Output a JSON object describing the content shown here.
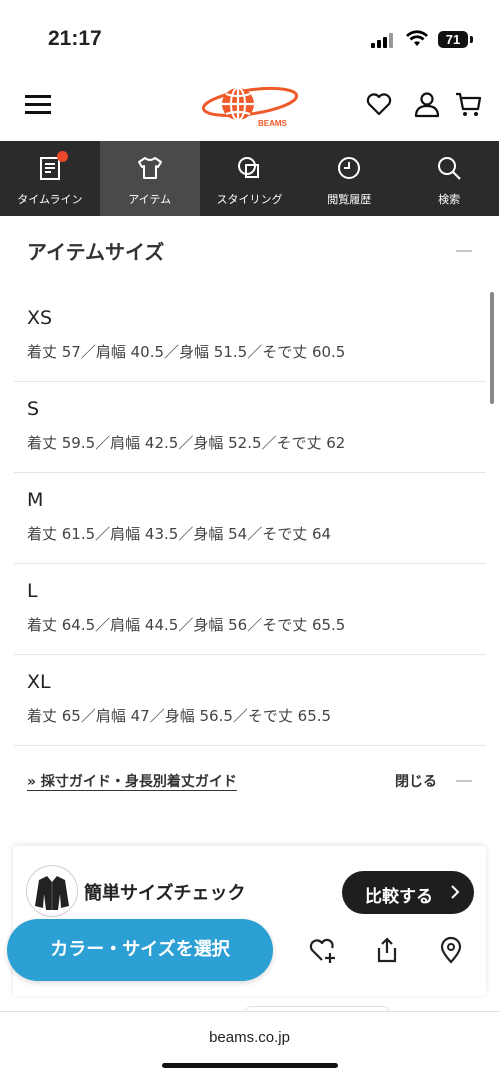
{
  "status_bar": {
    "time": "21:17",
    "battery": "71"
  },
  "header": {
    "logo_text": "BEAMS"
  },
  "tabs": [
    {
      "label": "タイムライン",
      "icon": "timeline-icon"
    },
    {
      "label": "アイテム",
      "icon": "tshirt-icon",
      "active": true
    },
    {
      "label": "スタイリング",
      "icon": "styling-icon"
    },
    {
      "label": "閲覧履歴",
      "icon": "clock-icon"
    },
    {
      "label": "検索",
      "icon": "search-icon"
    }
  ],
  "section": {
    "title": "アイテムサイズ"
  },
  "sizes": [
    {
      "name": "XS",
      "detail": "着丈 57／肩幅 40.5／身幅 51.5／そで丈 60.5"
    },
    {
      "name": "S",
      "detail": "着丈 59.5／肩幅 42.5／身幅 52.5／そで丈 62"
    },
    {
      "name": "M",
      "detail": "着丈 61.5／肩幅 43.5／身幅 54／そで丈 64"
    },
    {
      "name": "L",
      "detail": "着丈 64.5／肩幅 44.5／身幅 56／そで丈 65.5"
    },
    {
      "name": "XL",
      "detail": "着丈 65／肩幅 47／身幅 56.5／そで丈 65.5"
    }
  ],
  "guide": {
    "link_label": "» 採寸ガイド・身長別着丈ガイド",
    "close_label": "閉じる"
  },
  "size_check": {
    "title": "簡単サイズチェック",
    "compare_label": "比較する"
  },
  "actions": {
    "select_label": "カラー・サイズを選択"
  },
  "browser": {
    "url": "beams.co.jp"
  },
  "colors": {
    "brand": "#f05a28",
    "select_button": "#2c9fd4",
    "tabbar": "#2b2b2b"
  }
}
